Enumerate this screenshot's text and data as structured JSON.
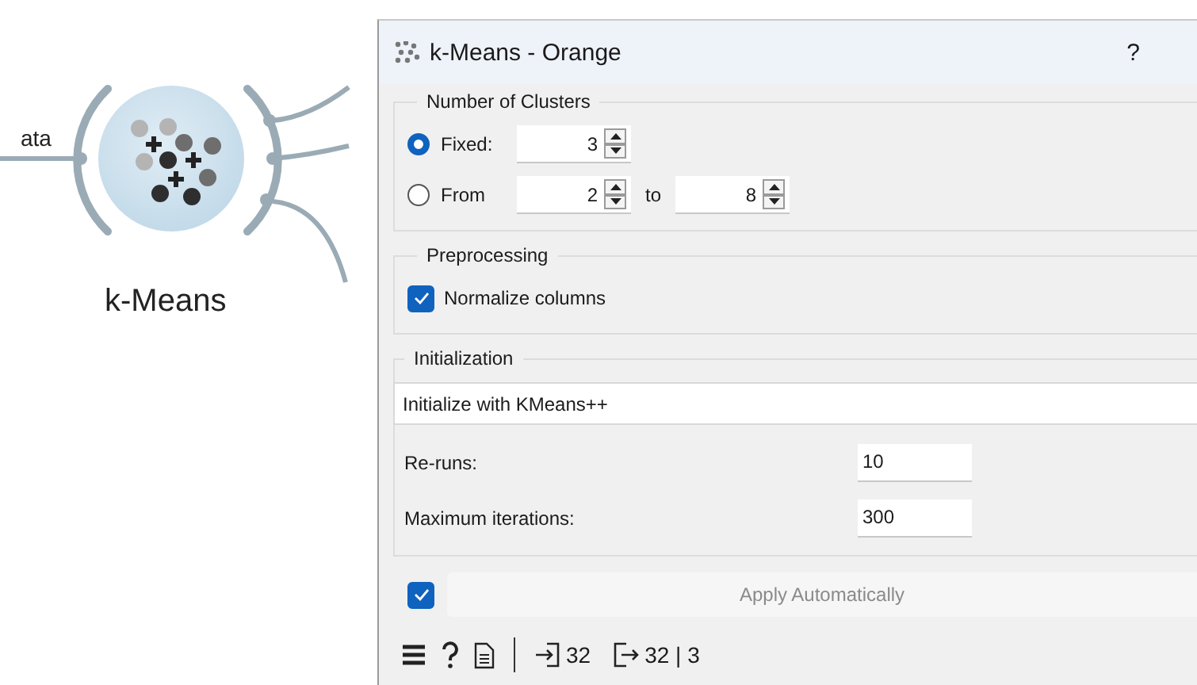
{
  "canvas": {
    "input_label": "ata",
    "node": {
      "label": "k-Means"
    }
  },
  "window": {
    "title": "k-Means - Orange",
    "help": "?"
  },
  "clusters": {
    "title": "Number of Clusters",
    "options": [
      {
        "label": "Fixed:",
        "selected": true,
        "fields": [
          {
            "value": "3"
          }
        ]
      },
      {
        "label": "From",
        "selected": false,
        "fields": [
          {
            "value": "2"
          },
          {
            "value": "8"
          }
        ],
        "between": "to"
      }
    ]
  },
  "preprocessing": {
    "title": "Preprocessing",
    "normalize": {
      "label": "Normalize columns",
      "checked": true
    }
  },
  "initialization": {
    "title": "Initialization",
    "method": "Initialize with KMeans++",
    "fields": [
      {
        "label": "Re-runs:",
        "value": "10"
      },
      {
        "label": "Maximum iterations:",
        "value": "300"
      }
    ]
  },
  "apply": {
    "checked": true,
    "label": "Apply Automatically"
  },
  "status_bar": {
    "input_count": "32",
    "output_count": "32 | 3"
  }
}
